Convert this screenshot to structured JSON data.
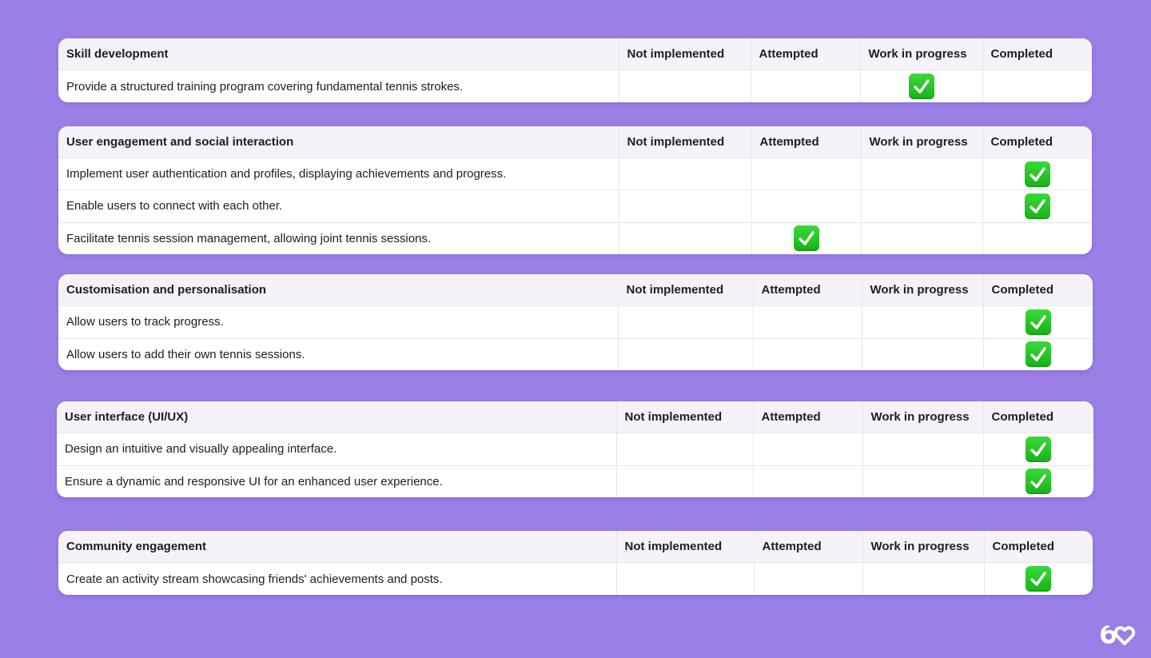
{
  "columns": [
    "Not implemented",
    "Attempted",
    "Work in progress",
    "Completed"
  ],
  "colors": {
    "background": "#9a7fe6",
    "check_green": "#22c022"
  },
  "sections": [
    {
      "title": "Skill development",
      "rows": [
        {
          "text": "Provide a structured training program covering fundamental tennis strokes.",
          "status": "Work in progress"
        }
      ]
    },
    {
      "title": "User engagement and social interaction",
      "rows": [
        {
          "text": "Implement user authentication and profiles, displaying achievements and progress.",
          "status": "Completed"
        },
        {
          "text": "Enable users to connect with each other.",
          "status": "Completed"
        },
        {
          "text": "Facilitate tennis session management, allowing joint tennis sessions.",
          "status": "Attempted"
        }
      ]
    },
    {
      "title": "Customisation and personalisation",
      "rows": [
        {
          "text": "Allow users to track progress.",
          "status": "Completed"
        },
        {
          "text": "Allow users to add their own tennis sessions.",
          "status": "Completed"
        }
      ]
    },
    {
      "title": "User interface (UI/UX)",
      "rows": [
        {
          "text": "Design an intuitive and visually appealing interface.",
          "status": "Completed"
        },
        {
          "text": "Ensure a dynamic and responsive UI for an enhanced user experience.",
          "status": "Completed"
        }
      ]
    },
    {
      "title": "Community engagement",
      "rows": [
        {
          "text": "Create an activity stream showcasing friends' achievements and posts.",
          "status": "Completed"
        }
      ]
    }
  ],
  "icons": {
    "check": "white-heavy-check-mark-icon",
    "logo": "sixty-heart-logo"
  }
}
